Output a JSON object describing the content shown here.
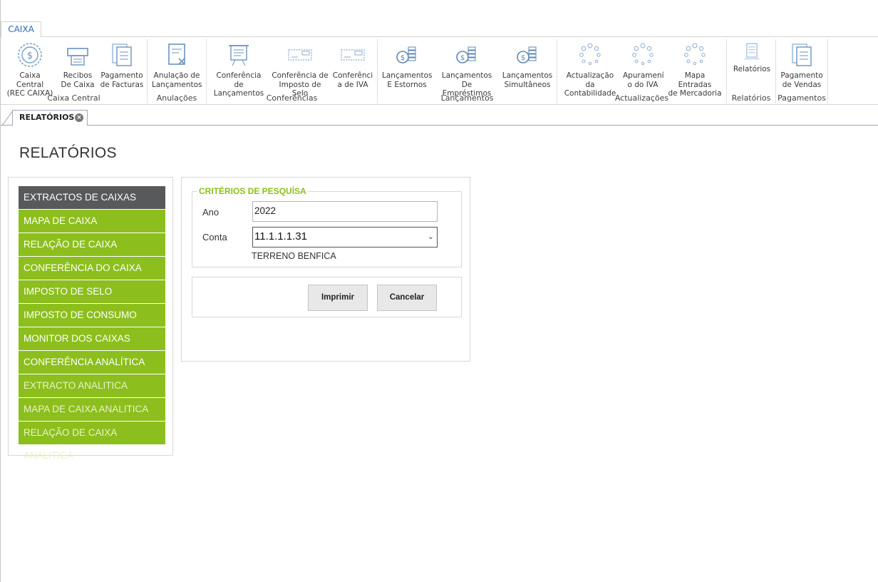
{
  "ribbon": {
    "tab": "CAIXA",
    "groups": [
      {
        "label": "Caixa Central",
        "buttons": [
          {
            "label": "Caixa Central\n(REC CAIXA)",
            "icon": "coin-dollar-icon"
          },
          {
            "label": "Recibos\nDe Caixa",
            "icon": "receipt-printer-icon"
          },
          {
            "label": "Pagamento\nde Facturas",
            "icon": "invoice-pages-icon"
          }
        ]
      },
      {
        "label": "Anulações",
        "buttons": [
          {
            "label": "Anulação de\nLançamentos",
            "icon": "document-cancel-icon"
          }
        ]
      },
      {
        "label": "Conferências",
        "buttons": [
          {
            "label": "Conferência de\nLançamentos",
            "icon": "presentation-board-icon"
          },
          {
            "label": "Conferência de\nImposto de Selo",
            "icon": "stamp-icon"
          },
          {
            "label": "Conferênci\na de IVA",
            "icon": "stamp-icon"
          }
        ]
      },
      {
        "label": "Lançamentos",
        "buttons": [
          {
            "label": "Lançamentos\nE Estornos",
            "icon": "coins-stack-icon"
          },
          {
            "label": "Lançamentos De\nEmpréstimos",
            "icon": "coins-stack-icon"
          },
          {
            "label": "Lançamentos\nSimultâneos",
            "icon": "coins-stack-icon"
          }
        ]
      },
      {
        "label": "Actualizações",
        "buttons": [
          {
            "label": "Actualização da\nContabilidade",
            "icon": "loading-spinner-icon"
          },
          {
            "label": "Apuramení\no do IVA",
            "icon": "loading-spinner-icon"
          },
          {
            "label": "Mapa Entradas\nde Mercadoria",
            "icon": "loading-spinner-icon"
          }
        ]
      },
      {
        "label": "Relatórios",
        "buttons": [
          {
            "label": "Relatórios",
            "icon": "report-document-icon"
          }
        ]
      },
      {
        "label": "Pagamentos",
        "buttons": [
          {
            "label": "Pagamento\nde Vendas",
            "icon": "invoice-pages-icon"
          }
        ]
      }
    ]
  },
  "doc_tab": {
    "label": "RELATÓRIOS"
  },
  "page": {
    "title": "RELATÓRIOS"
  },
  "menu": {
    "items": [
      {
        "label": "EXTRACTOS DE CAIXAS",
        "state": "active"
      },
      {
        "label": "MAPA DE CAIXA",
        "state": "normal"
      },
      {
        "label": "RELAÇÃO DE CAIXA",
        "state": "normal"
      },
      {
        "label": "CONFERÊNCIA DO CAIXA",
        "state": "normal"
      },
      {
        "label": "IMPOSTO DE SELO",
        "state": "normal"
      },
      {
        "label": "IMPOSTO DE CONSUMO",
        "state": "normal"
      },
      {
        "label": "MONITOR DOS CAIXAS",
        "state": "normal"
      },
      {
        "label": "CONFERÊNCIA ANALÍTICA",
        "state": "normal"
      },
      {
        "label": "EXTRACTO ANALITICA",
        "state": "dim"
      },
      {
        "label": "MAPA DE CAIXA ANALITICA",
        "state": "dim"
      },
      {
        "label": "RELAÇÃO DE CAIXA ANALITICA",
        "state": "dim"
      }
    ]
  },
  "form": {
    "legend": "CRITÉRIOS DE PESQUÍSA",
    "ano_label": "Ano",
    "ano_value": "2022",
    "conta_label": "Conta",
    "conta_value": "11.1.1.1.31",
    "conta_description": "TERRENO BENFICA",
    "print_label": "Imprimir",
    "cancel_label": "Cancelar"
  },
  "colors": {
    "accent_green": "#8cbf1d",
    "active_gray": "#58595b",
    "tab_blue": "#2a6ab8"
  }
}
